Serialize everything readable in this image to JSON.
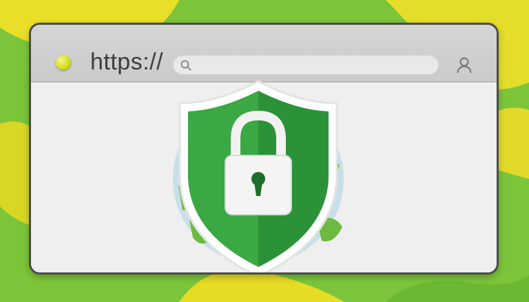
{
  "address_bar": {
    "protocol_text": "https://",
    "search_value": "",
    "search_placeholder": ""
  },
  "icons": {
    "status": "status-dot-icon",
    "search": "search-icon",
    "user": "user-icon",
    "hero": "security-shield-lock-icon",
    "globe": "globe-icon"
  },
  "colors": {
    "background_green": "#7cc53a",
    "background_yellow": "#e8dc25",
    "shield_green": "#2f9e3a",
    "window_border": "#4a4a4a"
  }
}
